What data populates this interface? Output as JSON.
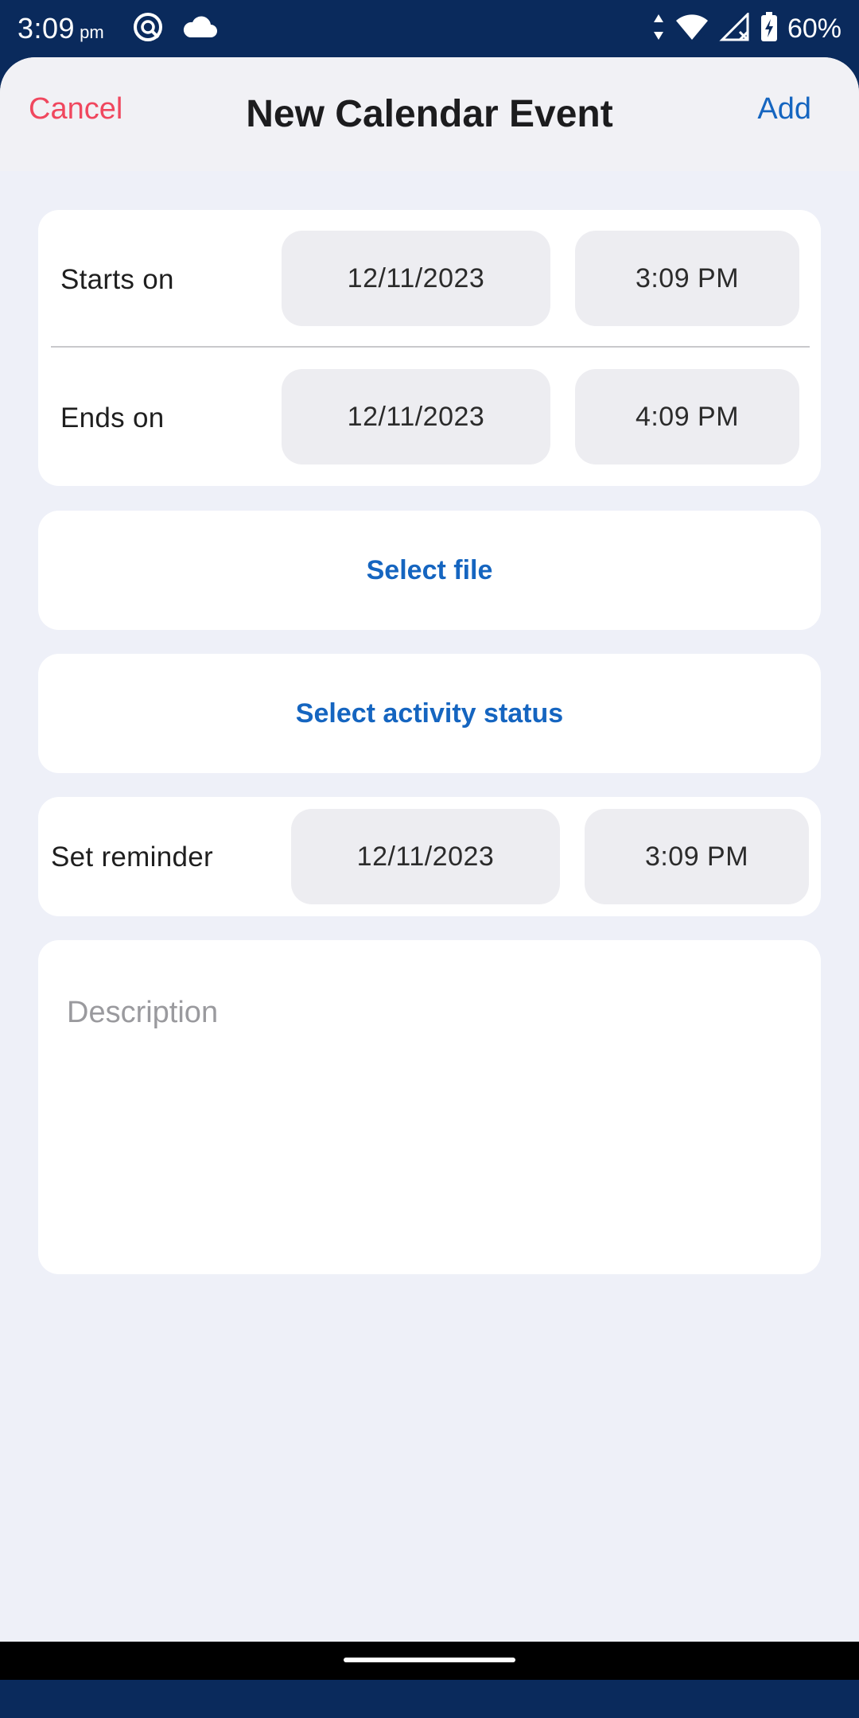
{
  "status_bar": {
    "time": "3:09",
    "ampm": "pm",
    "battery": "60%",
    "icons": [
      "data-saver-icon",
      "cloud-icon",
      "data-arrows-icon",
      "wifi-icon",
      "signal-off-icon",
      "battery-charging-icon"
    ]
  },
  "header": {
    "cancel_label": "Cancel",
    "title": "New Calendar Event",
    "add_label": "Add"
  },
  "starts": {
    "label": "Starts on",
    "date": "12/11/2023",
    "time": "3:09 PM"
  },
  "ends": {
    "label": "Ends on",
    "date": "12/11/2023",
    "time": "4:09 PM"
  },
  "select_file_label": "Select file",
  "select_status_label": "Select activity status",
  "reminder": {
    "label": "Set reminder",
    "date": "12/11/2023",
    "time": "3:09 PM"
  },
  "description": {
    "placeholder": "Description"
  },
  "colors": {
    "status_bar": "#0a2a5c",
    "cancel": "#f0475e",
    "accent": "#1565c0",
    "background": "#eef0f8"
  }
}
